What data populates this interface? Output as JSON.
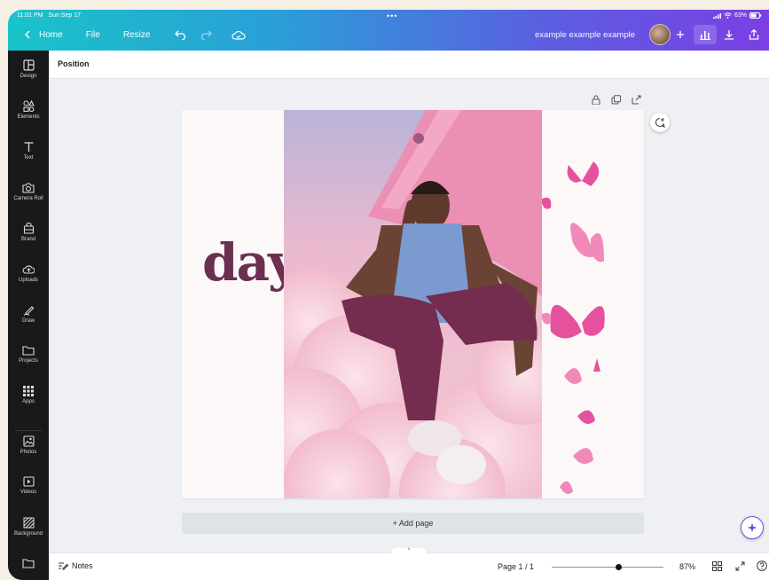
{
  "status_bar": {
    "time": "11:01 PM",
    "date": "Sun Sep 17",
    "battery": "63%"
  },
  "topbar": {
    "home_label": "Home",
    "file_label": "File",
    "resize_label": "Resize",
    "doc_title": "example example example"
  },
  "sidebar": {
    "items": [
      {
        "label": "Design",
        "icon": "design-icon"
      },
      {
        "label": "Elements",
        "icon": "elements-icon"
      },
      {
        "label": "Text",
        "icon": "text-icon"
      },
      {
        "label": "Camera Roll",
        "icon": "camera-icon"
      },
      {
        "label": "Brand",
        "icon": "brand-icon"
      },
      {
        "label": "Uploads",
        "icon": "upload-icon"
      },
      {
        "label": "Draw",
        "icon": "draw-icon"
      },
      {
        "label": "Projects",
        "icon": "folder-icon"
      },
      {
        "label": "Apps",
        "icon": "apps-icon"
      },
      {
        "label": "Photos",
        "icon": "photos-icon"
      },
      {
        "label": "Videos",
        "icon": "videos-icon"
      },
      {
        "label": "Background",
        "icon": "background-icon"
      }
    ]
  },
  "position_bar": {
    "label": "Position"
  },
  "canvas": {
    "word": "day"
  },
  "add_page": {
    "label": "+ Add page"
  },
  "bottom_bar": {
    "notes_label": "Notes",
    "page_indicator": "Page 1 / 1",
    "zoom_level": "87%",
    "zoom_fraction": 0.6
  },
  "colors": {
    "accent_start": "#19c3c9",
    "accent_end": "#7b3fe4",
    "sidebar_bg": "#18191b",
    "word_color": "#6b2f52"
  }
}
